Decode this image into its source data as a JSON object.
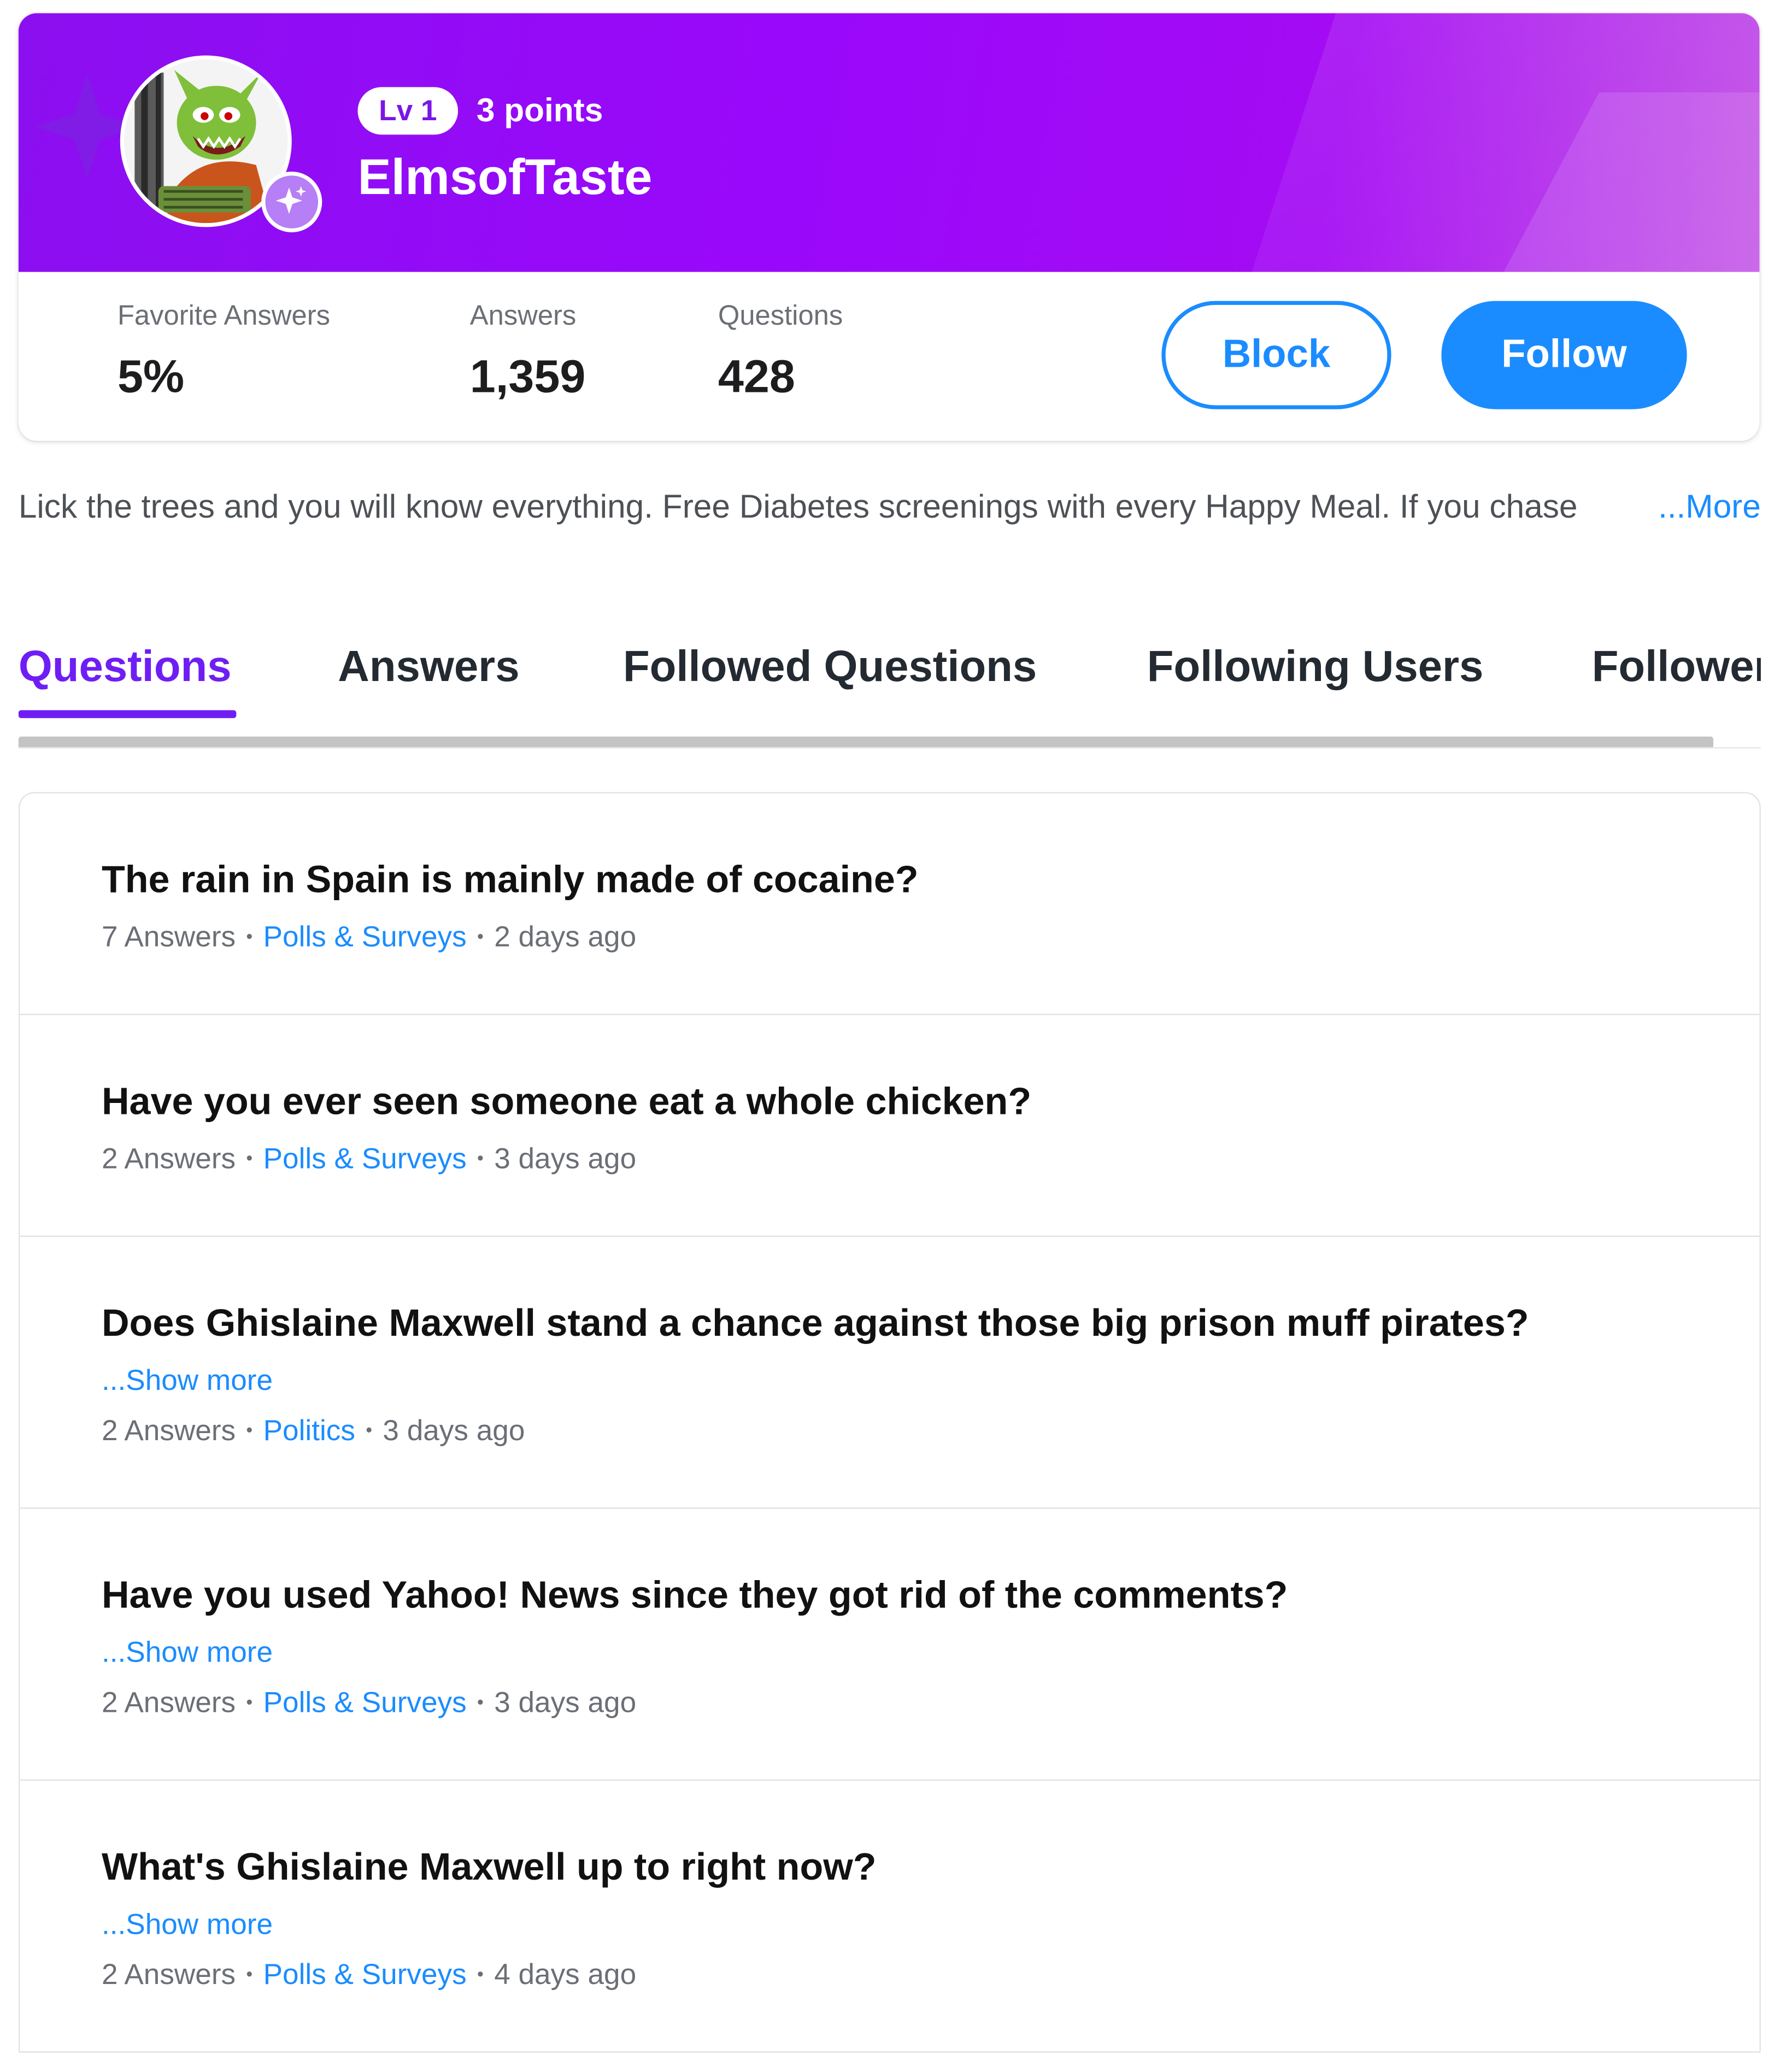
{
  "profile": {
    "level_label": "Lv 1",
    "points_label": "3 points",
    "username": "ElmsofTaste"
  },
  "stats": [
    {
      "label": "Favorite Answers",
      "value": "5%"
    },
    {
      "label": "Answers",
      "value": "1,359"
    },
    {
      "label": "Questions",
      "value": "428"
    }
  ],
  "actions": {
    "block_label": "Block",
    "follow_label": "Follow"
  },
  "bio": {
    "text": "Lick the trees and you will know everything. Free Diabetes screenings with every Happy Meal. If you chase",
    "more_label": "...More"
  },
  "tabs": [
    {
      "label": "Questions",
      "active": true
    },
    {
      "label": "Answers"
    },
    {
      "label": "Followed Questions"
    },
    {
      "label": "Following Users"
    },
    {
      "label": "Followers"
    }
  ],
  "questions": [
    {
      "title": "The rain in Spain is mainly made of cocaine?",
      "answers": "7 Answers",
      "category": "Polls & Surveys",
      "time": "2 days ago"
    },
    {
      "title": "Have you ever seen someone eat a whole chicken?",
      "answers": "2 Answers",
      "category": "Polls & Surveys",
      "time": "3 days ago"
    },
    {
      "title": "Does Ghislaine Maxwell stand a chance against those big prison muff pirates?",
      "show_more": "...Show more",
      "answers": "2 Answers",
      "category": "Politics",
      "time": "3 days ago"
    },
    {
      "title": "Have you used Yahoo! News since they got rid of the comments?",
      "show_more": "...Show more",
      "answers": "2 Answers",
      "category": "Polls & Surveys",
      "time": "3 days ago"
    },
    {
      "title": "What's Ghislaine Maxwell up to right now?",
      "show_more": "...Show more",
      "answers": "2 Answers",
      "category": "Polls & Surveys",
      "time": "4 days ago"
    }
  ],
  "colors": {
    "brand_purple": "#9a08fb",
    "accent_blue": "#1a8cff",
    "tab_active": "#6e1ef5"
  },
  "icons": {
    "avatar": "cartoon-goblin-avatar",
    "badge": "sparkles-icon"
  }
}
